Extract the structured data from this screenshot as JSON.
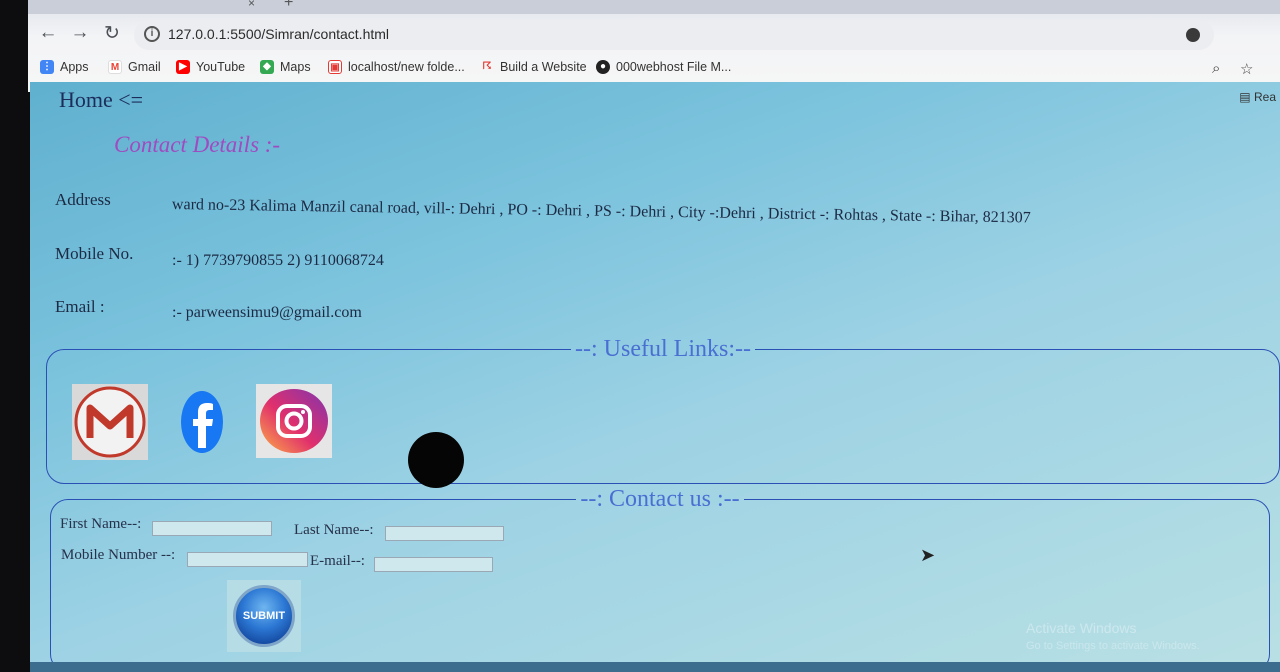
{
  "browser": {
    "url": "127.0.0.1:5500/Simran/contact.html",
    "bookmarks": [
      {
        "label": "Apps",
        "icon": "apps-grid-icon",
        "color": "#4285f4"
      },
      {
        "label": "Gmail",
        "icon": "gmail-icon",
        "color": "#ea4335"
      },
      {
        "label": "YouTube",
        "icon": "youtube-icon",
        "color": "#ff0000"
      },
      {
        "label": "Maps",
        "icon": "maps-icon",
        "color": "#34a853"
      },
      {
        "label": "localhost/new folde...",
        "icon": "localhost-icon",
        "color": "#e53935"
      },
      {
        "label": "Build a Website",
        "icon": "build-website-icon",
        "color": "#e53935"
      },
      {
        "label": "000webhost File M...",
        "icon": "webhost-icon",
        "color": "#222222"
      }
    ],
    "reading_list": "Rea"
  },
  "page": {
    "home_link": "Home <=",
    "contact_title": "Contact Details :-",
    "address_label": "Address",
    "address_value": "ward no-23 Kalima Manzil canal road, vill-: Dehri , PO -: Dehri , PS -: Dehri , City -:Dehri , District -: Rohtas , State -: Bihar, 821307",
    "mobile_label": "Mobile No.",
    "mobile_value": ":- 1) 7739790855   2) 9110068724",
    "email_label": "Email :",
    "email_value": ":- parweensimu9@gmail.com",
    "useful_links_legend": "--: Useful Links:--",
    "useful_links": [
      {
        "name": "gmail-link",
        "icon": "gmail-icon"
      },
      {
        "name": "facebook-link",
        "icon": "facebook-icon"
      },
      {
        "name": "instagram-link",
        "icon": "instagram-icon"
      }
    ],
    "contact_us_legend": "--: Contact us :--",
    "form": {
      "first_name_label": "First Name--:",
      "last_name_label": "Last Name--:",
      "mobile_label": "Mobile Number --:",
      "email_label": "E-mail--:",
      "submit_label": "SUBMIT"
    },
    "watermark": {
      "title": "Activate Windows",
      "subtitle": "Go to Settings to activate Windows."
    }
  },
  "colors": {
    "title_purple": "#a04bc0",
    "legend_blue": "#4a6fd2",
    "border_blue": "#2a4fb5"
  }
}
